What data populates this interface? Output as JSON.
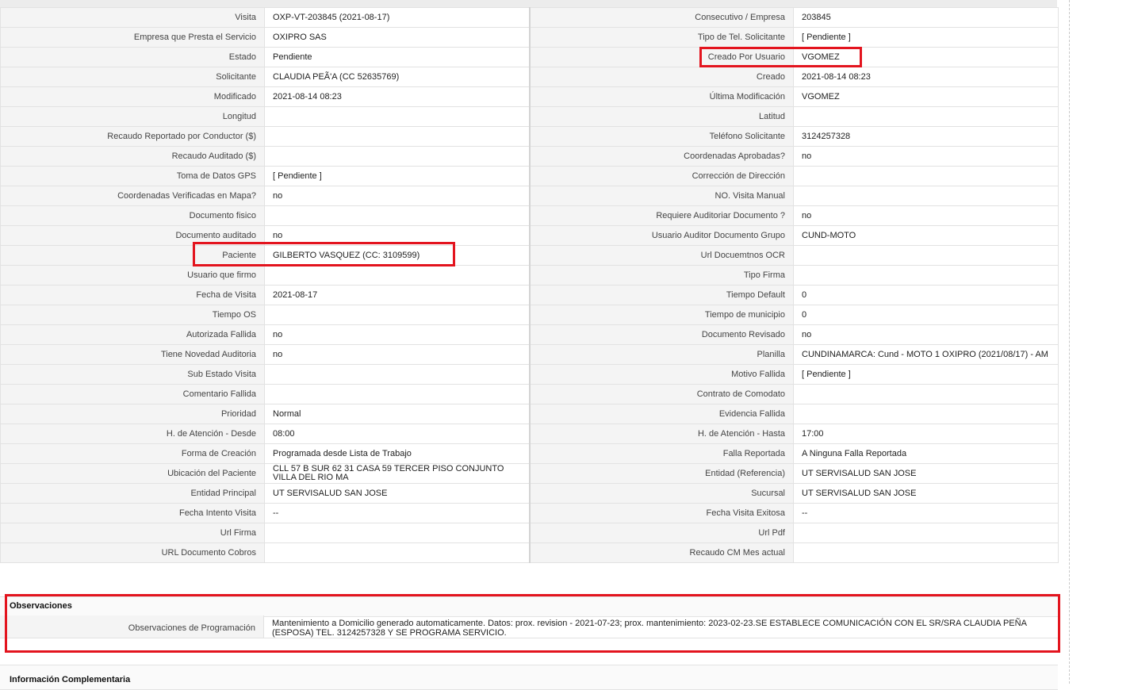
{
  "details": {
    "rows": [
      {
        "l1": "Visita",
        "v1": "OXP-VT-203845 (2021-08-17)",
        "l2": "Consecutivo / Empresa",
        "v2": "203845"
      },
      {
        "l1": "Empresa que Presta el Servicio",
        "v1": "OXIPRO SAS",
        "l2": "Tipo de Tel. Solicitante",
        "v2": "[ Pendiente ]"
      },
      {
        "l1": "Estado",
        "v1": "Pendiente",
        "l2": "Creado Por Usuario",
        "v2": "VGOMEZ"
      },
      {
        "l1": "Solicitante",
        "v1": "CLAUDIA PEÃ'A (CC 52635769)",
        "l2": "Creado",
        "v2": "2021-08-14 08:23"
      },
      {
        "l1": "Modificado",
        "v1": "2021-08-14 08:23",
        "l2": "Última Modificación",
        "v2": " VGOMEZ"
      },
      {
        "l1": "Longitud",
        "v1": "",
        "l2": "Latitud",
        "v2": ""
      },
      {
        "l1": "Recaudo Reportado por Conductor ($)",
        "v1": "",
        "l2": "Teléfono Solicitante",
        "v2": "3124257328"
      },
      {
        "l1": "Recaudo Auditado ($)",
        "v1": "",
        "l2": "Coordenadas Aprobadas?",
        "v2": " no"
      },
      {
        "l1": "Toma de Datos GPS",
        "v1": "[ Pendiente ]",
        "l2": "Corrección de Dirección",
        "v2": ""
      },
      {
        "l1": "Coordenadas Verificadas en Mapa?",
        "v1": " no",
        "l2": "NO. Visita Manual",
        "v2": ""
      },
      {
        "l1": "Documento fisico",
        "v1": "",
        "l2": "Requiere Auditoriar Documento ?",
        "v2": " no"
      },
      {
        "l1": "Documento auditado",
        "v1": " no",
        "l2": "Usuario Auditor Documento Grupo",
        "v2": "CUND-MOTO"
      },
      {
        "l1": "Paciente",
        "v1": "GILBERTO VASQUEZ (CC: 3109599)",
        "l2": "Url Docuemtnos OCR",
        "v2": ""
      },
      {
        "l1": "Usuario que firmo",
        "v1": "",
        "l2": "Tipo Firma",
        "v2": ""
      },
      {
        "l1": "Fecha de Visita",
        "v1": " 2021-08-17",
        "l2": "Tiempo Default",
        "v2": "0"
      },
      {
        "l1": "Tiempo OS",
        "v1": "",
        "l2": "Tiempo de municipio",
        "v2": "0"
      },
      {
        "l1": "Autorizada Fallida",
        "v1": " no",
        "l2": "Documento Revisado",
        "v2": " no"
      },
      {
        "l1": "Tiene Novedad Auditoria",
        "v1": " no",
        "l2": "Planilla",
        "v2": "CUNDINAMARCA: Cund - MOTO 1 OXIPRO (2021/08/17) - AM"
      },
      {
        "l1": "Sub Estado Visita",
        "v1": "",
        "l2": "Motivo Fallida",
        "v2": "[ Pendiente ]"
      },
      {
        "l1": "Comentario Fallida",
        "v1": "",
        "l2": "Contrato de Comodato",
        "v2": ""
      },
      {
        "l1": "Prioridad",
        "v1": "Normal",
        "l2": "Evidencia Fallida",
        "v2": ""
      },
      {
        "l1": "H. de Atención - Desde",
        "v1": "08:00",
        "l2": "H. de Atención - Hasta",
        "v2": "17:00"
      },
      {
        "l1": "Forma de Creación",
        "v1": "Programada desde Lista de Trabajo",
        "l2": "Falla Reportada",
        "v2": "A Ninguna Falla Reportada"
      },
      {
        "l1": "Ubicación del Paciente",
        "v1": "CLL 57 B SUR 62 31 CASA 59 TERCER PISO CONJUNTO VILLA DEL RIO MA",
        "l2": "Entidad (Referencia)",
        "v2": "UT SERVISALUD SAN JOSE"
      },
      {
        "l1": "Entidad Principal",
        "v1": "UT SERVISALUD SAN JOSE",
        "l2": "Sucursal",
        "v2": "UT SERVISALUD SAN JOSE"
      },
      {
        "l1": "Fecha Intento Visita",
        "v1": " --",
        "l2": "Fecha Visita Exitosa",
        "v2": " --"
      },
      {
        "l1": "Url Firma",
        "v1": "",
        "l2": "Url Pdf",
        "v2": ""
      },
      {
        "l1": "URL Documento Cobros",
        "v1": "",
        "l2": "Recaudo CM Mes actual",
        "v2": ""
      }
    ]
  },
  "observaciones": {
    "title": "Observaciones",
    "label": "Observaciones de Programación",
    "value": "Mantenimiento a Domicilio generado automaticamente. Datos: prox. revision - 2021-07-23; prox. mantenimiento: 2023-02-23.SE ESTABLECE COMUNICACIÓN CON EL SR/SRA CLAUDIA PEÑA (ESPOSA) TEL. 3124257328 Y SE PROGRAMA SERVICIO."
  },
  "complementaria": {
    "title": "Información Complementaria"
  },
  "colors": {
    "highlight": "#e3141e",
    "label_bg": "#f4f4f4",
    "border": "#e2e2e2"
  }
}
